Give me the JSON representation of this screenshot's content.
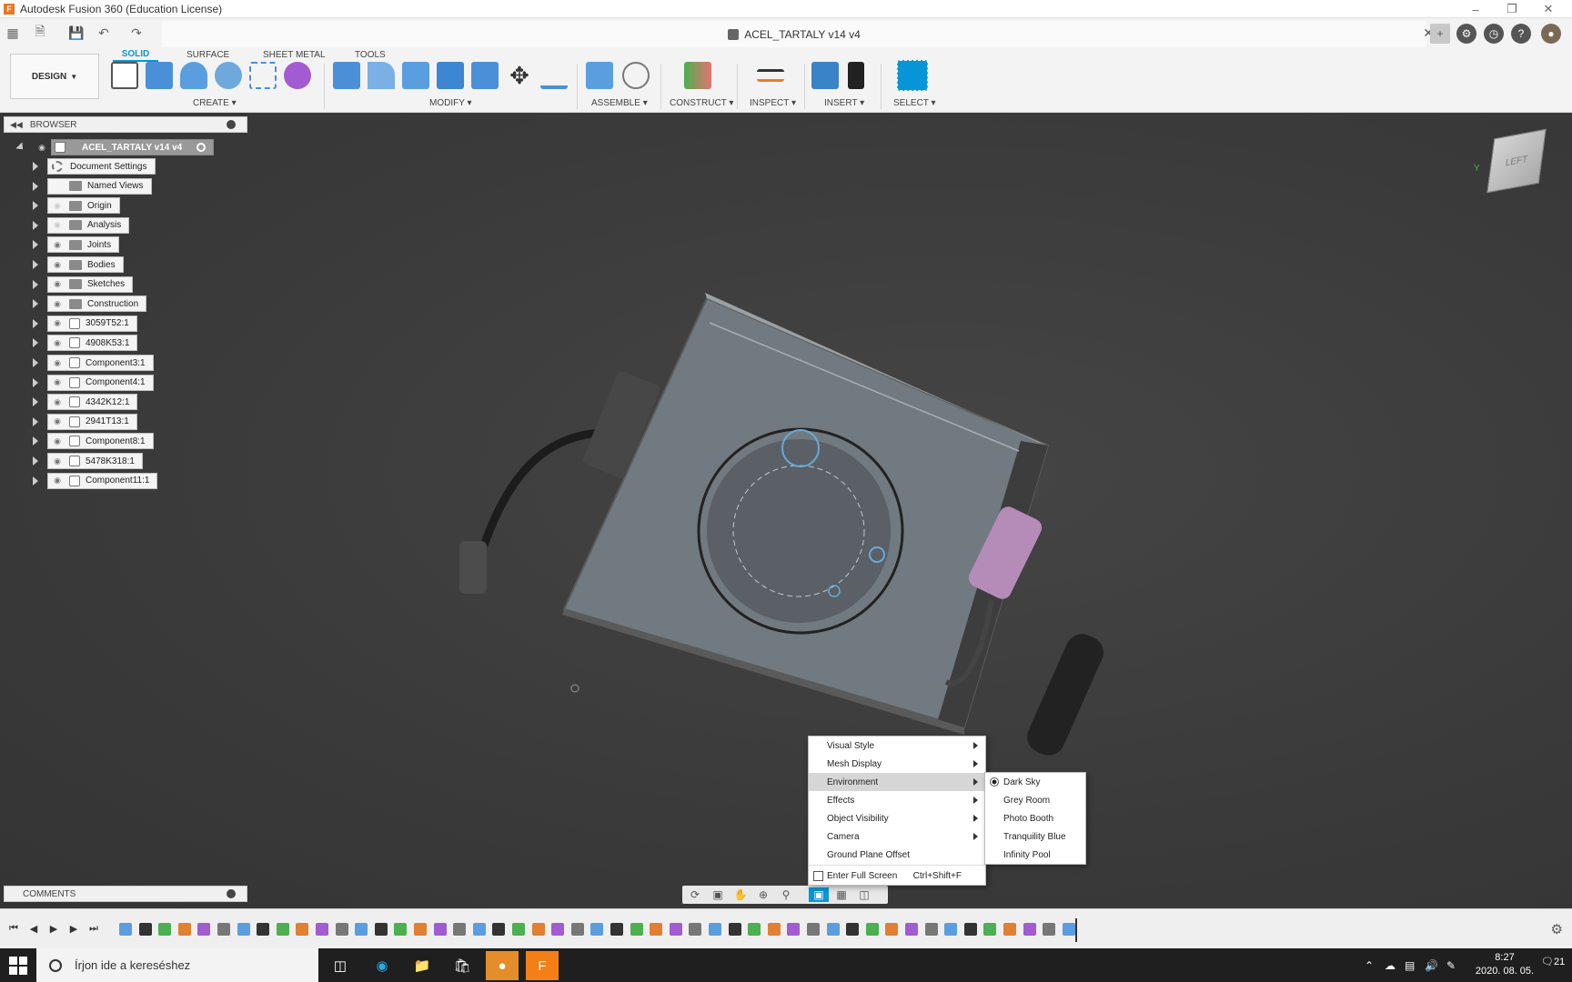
{
  "window": {
    "title": "Autodesk Fusion 360 (Education License)",
    "app_logo": "F"
  },
  "document": {
    "tab_title": "ACEL_TARTALY v14 v4"
  },
  "ribbon": {
    "workspace": "DESIGN",
    "tabs": [
      "SOLID",
      "SURFACE",
      "SHEET METAL",
      "TOOLS"
    ],
    "active_tab": "SOLID",
    "groups": [
      "CREATE",
      "MODIFY",
      "ASSEMBLE",
      "CONSTRUCT",
      "INSPECT",
      "INSERT",
      "SELECT"
    ]
  },
  "browser": {
    "header": "BROWSER",
    "root": "ACEL_TARTALY v14 v4",
    "items": [
      {
        "label": "Document Settings",
        "icon": "gear-icon",
        "eye": false
      },
      {
        "label": "Named Views",
        "icon": "folder-icon",
        "eye": false
      },
      {
        "label": "Origin",
        "icon": "folder-icon",
        "eye": "dim"
      },
      {
        "label": "Analysis",
        "icon": "folder-icon",
        "eye": "dim"
      },
      {
        "label": "Joints",
        "icon": "folder-icon",
        "eye": true
      },
      {
        "label": "Bodies",
        "icon": "folder-icon",
        "eye": true
      },
      {
        "label": "Sketches",
        "icon": "folder-icon",
        "eye": true
      },
      {
        "label": "Construction",
        "icon": "folder-icon",
        "eye": true
      },
      {
        "label": "3059T52:1",
        "icon": "component-icon",
        "eye": true
      },
      {
        "label": "4908K53:1",
        "icon": "component-icon",
        "eye": true
      },
      {
        "label": "Component3:1",
        "icon": "component-icon",
        "eye": true
      },
      {
        "label": "Component4:1",
        "icon": "component-icon",
        "eye": true
      },
      {
        "label": "4342K12:1",
        "icon": "component-icon",
        "eye": true
      },
      {
        "label": "2941T13:1",
        "icon": "linked-component-icon",
        "eye": true
      },
      {
        "label": "Component8:1",
        "icon": "component-icon",
        "eye": true
      },
      {
        "label": "5478K318:1",
        "icon": "linked-component-icon",
        "eye": true
      },
      {
        "label": "Component11:1",
        "icon": "component-icon",
        "eye": true
      }
    ]
  },
  "comments": {
    "header": "COMMENTS"
  },
  "viewcube": {
    "face": "LEFT",
    "axis": "Y"
  },
  "display_menu": {
    "items": [
      {
        "label": "Visual Style",
        "submenu": true
      },
      {
        "label": "Mesh Display",
        "submenu": true
      },
      {
        "label": "Environment",
        "submenu": true,
        "highlighted": true
      },
      {
        "label": "Effects",
        "submenu": true
      },
      {
        "label": "Object Visibility",
        "submenu": true
      },
      {
        "label": "Camera",
        "submenu": true
      },
      {
        "label": "Ground Plane Offset",
        "submenu": false
      }
    ],
    "fullscreen": {
      "label": "Enter Full Screen",
      "shortcut": "Ctrl+Shift+F"
    }
  },
  "environment_menu": {
    "items": [
      "Dark Sky",
      "Grey Room",
      "Photo Booth",
      "Tranquility Blue",
      "Infinity Pool"
    ],
    "selected": "Dark Sky"
  },
  "taskbar": {
    "search_placeholder": "Írjon ide a kereséshez",
    "time": "8:27",
    "date": "2020. 08. 05.",
    "notifications": "21"
  },
  "colors": {
    "accent": "#0696d7",
    "viewport": "#3a3a3a",
    "menu_highlight": "#d6d6d6"
  }
}
